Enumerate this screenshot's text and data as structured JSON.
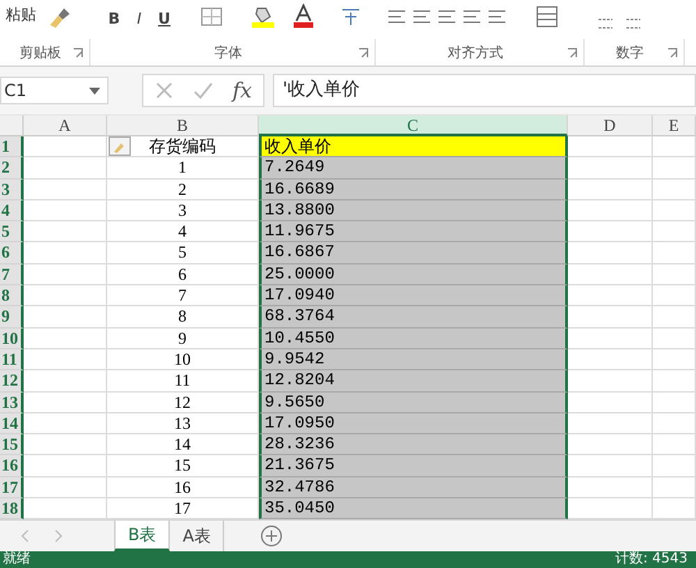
{
  "ribbon": {
    "paste": "粘贴",
    "font_buttons": [
      "B",
      "I",
      "U"
    ],
    "groups": [
      {
        "label": "剪贴板"
      },
      {
        "label": "字体"
      },
      {
        "label": "对齐方式"
      },
      {
        "label": "数字"
      }
    ]
  },
  "formula_bar": {
    "name_box": "C1",
    "fx": "fx",
    "value": "'收入单价"
  },
  "columns": [
    {
      "label": "A",
      "selected": false
    },
    {
      "label": "B",
      "selected": false
    },
    {
      "label": "C",
      "selected": true
    },
    {
      "label": "D",
      "selected": false
    },
    {
      "label": "E",
      "selected": false
    }
  ],
  "rows": [
    {
      "num": "1",
      "selected": true,
      "b": "存货编码",
      "c": "收入单价",
      "kind": "header"
    },
    {
      "num": "2",
      "selected": true,
      "b": "1",
      "c": "7.2649",
      "kind": "data"
    },
    {
      "num": "3",
      "selected": true,
      "b": "2",
      "c": "16.6689",
      "kind": "data"
    },
    {
      "num": "4",
      "selected": true,
      "b": "3",
      "c": "13.8800",
      "kind": "data"
    },
    {
      "num": "5",
      "selected": true,
      "b": "4",
      "c": "11.9675",
      "kind": "data"
    },
    {
      "num": "6",
      "selected": true,
      "b": "5",
      "c": "16.6867",
      "kind": "data"
    },
    {
      "num": "7",
      "selected": true,
      "b": "6",
      "c": "25.0000",
      "kind": "data"
    },
    {
      "num": "8",
      "selected": true,
      "b": "7",
      "c": "17.0940",
      "kind": "data"
    },
    {
      "num": "9",
      "selected": true,
      "b": "8",
      "c": "68.3764",
      "kind": "data"
    },
    {
      "num": "10",
      "selected": true,
      "b": "9",
      "c": "10.4550",
      "kind": "data"
    },
    {
      "num": "11",
      "selected": true,
      "b": "10",
      "c": "9.9542",
      "kind": "data"
    },
    {
      "num": "12",
      "selected": true,
      "b": "11",
      "c": "12.8204",
      "kind": "data"
    },
    {
      "num": "13",
      "selected": true,
      "b": "12",
      "c": "9.5650",
      "kind": "data"
    },
    {
      "num": "14",
      "selected": true,
      "b": "13",
      "c": "17.0950",
      "kind": "data"
    },
    {
      "num": "15",
      "selected": true,
      "b": "14",
      "c": "28.3236",
      "kind": "data"
    },
    {
      "num": "16",
      "selected": true,
      "b": "15",
      "c": "21.3675",
      "kind": "data"
    },
    {
      "num": "17",
      "selected": true,
      "b": "16",
      "c": "32.4786",
      "kind": "data"
    },
    {
      "num": "18",
      "selected": true,
      "b": "17",
      "c": "35.0450",
      "kind": "data"
    }
  ],
  "sheets": [
    {
      "label": "B表",
      "selected": true
    },
    {
      "label": "A表",
      "selected": false
    }
  ],
  "status_bar": {
    "state": "就绪",
    "count": "计数: 4543"
  }
}
